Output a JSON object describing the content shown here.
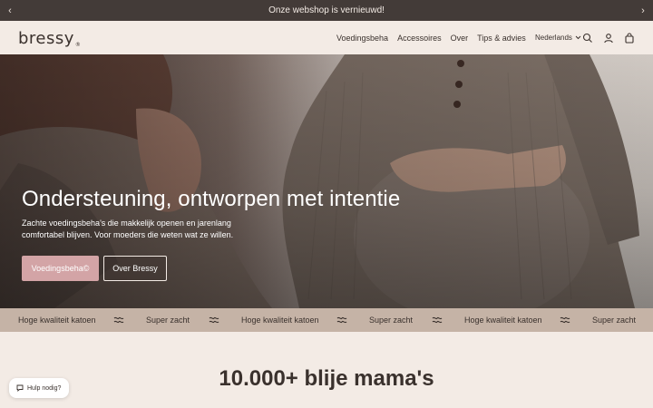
{
  "announcement": {
    "text": "Onze webshop is vernieuwd!",
    "prev_icon": "chevron-left-icon",
    "next_icon": "chevron-right-icon"
  },
  "header": {
    "logo": "bressy",
    "logo_mark": "®",
    "nav": [
      "Voedingsbeha",
      "Accessoires",
      "Over",
      "Tips & advies"
    ],
    "language": "Nederlands",
    "icons": [
      "search-icon",
      "account-icon",
      "cart-icon"
    ]
  },
  "hero": {
    "title": "Ondersteuning, ontworpen met intentie",
    "subtitle": "Zachte voedingsbeha's die makkelijk openen en jarenlang comfortabel blijven. Voor moeders die weten wat ze willen.",
    "primary_button": "Voedingsbeha©",
    "secondary_button": "Over Bressy"
  },
  "marquee": {
    "items": [
      "Hoge kwaliteit katoen",
      "Super zacht",
      "Hoge kwaliteit katoen",
      "Super zacht",
      "Hoge kwaliteit katoen",
      "Super zacht"
    ],
    "separator_icon": "bressy-mark-icon"
  },
  "section": {
    "title": "10.000+ blije mama's"
  },
  "help": {
    "label": "Hulp nodig?",
    "icon": "chat-icon"
  },
  "colors": {
    "background": "#f3ebe5",
    "announcement_bar": "#433b38",
    "marquee_bar": "#c5b3a6",
    "primary_button": "#d3a4a6",
    "text": "#3a312d"
  }
}
